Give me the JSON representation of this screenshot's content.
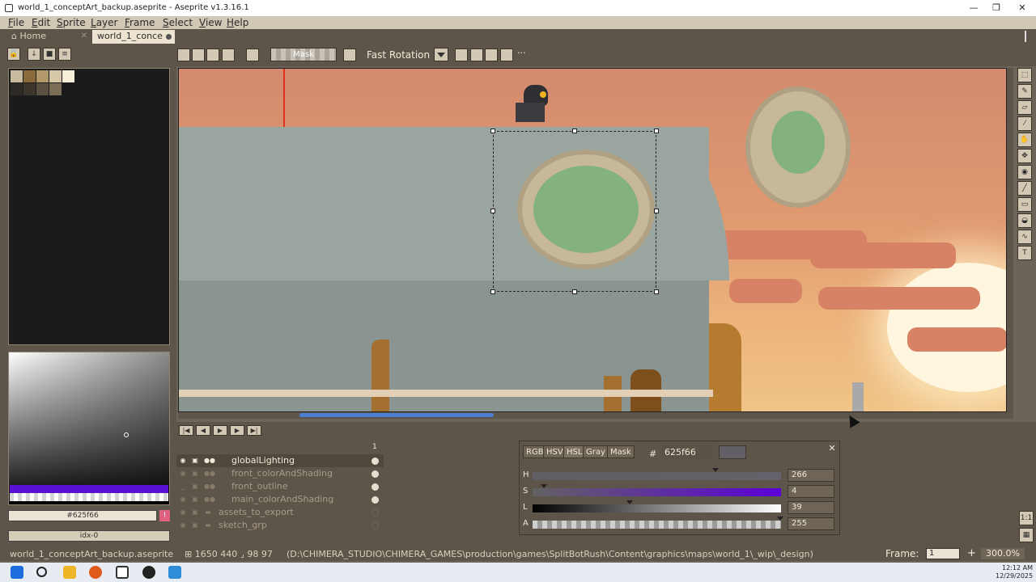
{
  "window": {
    "title": "world_1_conceptArt_backup.aseprite - Aseprite v1.3.16.1",
    "minimize": "—",
    "maximize": "❐",
    "close": "✕"
  },
  "menu": [
    "File",
    "Edit",
    "Sprite",
    "Layer",
    "Frame",
    "Select",
    "View",
    "Help"
  ],
  "tabs": [
    {
      "label": "Home",
      "close": "✕"
    },
    {
      "label": "world_1_conce",
      "active": true
    }
  ],
  "context_bar": {
    "mask_label": "Mask",
    "rotation_algorithm": "Fast Rotation",
    "more": "···"
  },
  "color_panel": {
    "hex": "#625f66",
    "index": "idx-0",
    "warn": "!"
  },
  "timeline": {
    "frame_header": "1",
    "layers": [
      {
        "name": "globalLighting",
        "selected": true,
        "visible": true,
        "cel": true
      },
      {
        "name": "front_colorAndShading",
        "visible": true,
        "cel": true
      },
      {
        "name": "front_outline",
        "visible": false,
        "cel": true
      },
      {
        "name": "main_colorAndShading",
        "visible": true,
        "cel": true
      },
      {
        "name": "assets_to_export",
        "visible": true,
        "cel": false
      },
      {
        "name": "sketch_grp",
        "visible": true,
        "cel": false
      }
    ]
  },
  "color_popup": {
    "modes": [
      "RGB",
      "HSV",
      "HSL",
      "Gray",
      "Mask"
    ],
    "active_mode": "HSL",
    "hash": "#",
    "hex": "625f66",
    "swatch_color": "#625f66",
    "close": "✕",
    "sliders": [
      {
        "label": "H",
        "value": "266"
      },
      {
        "label": "S",
        "value": "4"
      },
      {
        "label": "L",
        "value": "39"
      },
      {
        "label": "A",
        "value": "255"
      }
    ]
  },
  "status": {
    "file": "world_1_conceptArt_backup.aseprite",
    "position": "1650 440",
    "size": "98 97",
    "path": "(D:\\CHIMERA_STUDIO\\CHIMERA_GAMES\\production\\games\\SplitBotRush\\Content\\graphics\\maps\\world_1\\_wip\\_design)",
    "frame_label": "Frame:",
    "frame_value": "1",
    "zoom_plus": "+",
    "zoom": "300.0%"
  },
  "clock": {
    "time": "12:12 AM",
    "date": "12/29/2025"
  }
}
